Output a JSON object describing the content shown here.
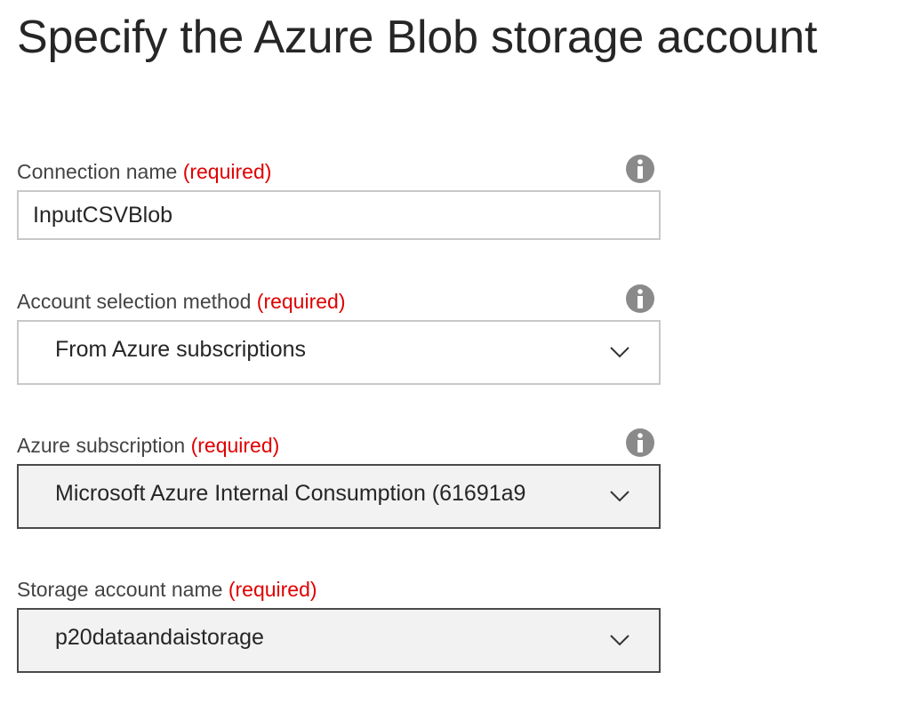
{
  "page": {
    "title": "Specify the Azure Blob storage account"
  },
  "form": {
    "connection_name": {
      "label": "Connection name",
      "required": "(required)",
      "value": "InputCSVBlob",
      "info_icon": "info-icon"
    },
    "account_selection_method": {
      "label": "Account selection method",
      "required": "(required)",
      "value": "From Azure subscriptions",
      "info_icon": "info-icon",
      "chevron_icon": "chevron-down-icon"
    },
    "azure_subscription": {
      "label": "Azure subscription",
      "required": "(required)",
      "value": "Microsoft Azure Internal Consumption (61691a9",
      "info_icon": "info-icon",
      "chevron_icon": "chevron-down-icon"
    },
    "storage_account_name": {
      "label": "Storage account name",
      "required": "(required)",
      "value": "p20dataandaistorage",
      "chevron_icon": "chevron-down-icon"
    }
  },
  "colors": {
    "required": "#e00000",
    "text": "#262626",
    "label": "#444444",
    "info_icon_bg": "#8a8a8a",
    "input_border": "#c8c8c8",
    "disabled_bg": "#f2f2f2"
  }
}
